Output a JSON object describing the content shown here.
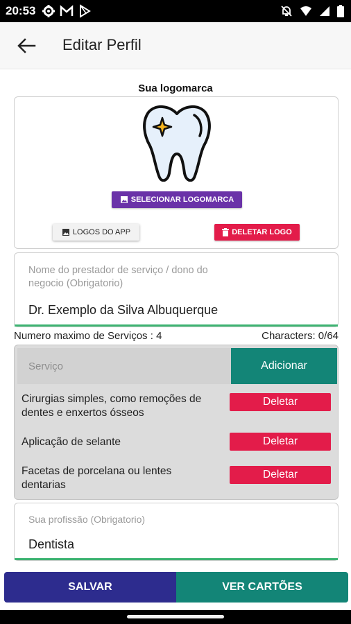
{
  "status_bar": {
    "time": "20:53",
    "left_icons": [
      "gear-icon",
      "gmail-icon",
      "play-store-icon"
    ],
    "right_icons": [
      "notifications-off-icon",
      "wifi-icon",
      "signal-icon",
      "battery-icon"
    ]
  },
  "app_bar": {
    "title": "Editar Perfil",
    "back_icon": "arrow-back-icon"
  },
  "logo_section": {
    "label": "Sua logomarca",
    "select_button": "SELECIONAR LOGOMARCA",
    "app_logos_button": "LOGOS DO APP",
    "delete_button": "DELETAR LOGO"
  },
  "name_field": {
    "placeholder_line1": "Nome do prestador de serviço / dono do",
    "placeholder_line2": "negocio (Obrigatorio)",
    "value": "Dr. Exemplo da Silva Albuquerque"
  },
  "counters": {
    "max_services": "Numero maximo de Serviços : 4",
    "characters": "Characters: 0/64"
  },
  "services": {
    "input_placeholder": "Serviço",
    "add_button": "Adicionar",
    "delete_label": "Deletar",
    "items": [
      {
        "line1": "Cirurgias simples, como remoções de",
        "line2": "dentes e enxertos ósseos"
      },
      {
        "line1": "Aplicação de selante",
        "line2": ""
      },
      {
        "line1": "Facetas de porcelana ou lentes",
        "line2": "dentarias"
      }
    ]
  },
  "profession_field": {
    "placeholder": "Sua profissão (Obrigatorio)",
    "value": "Dentista"
  },
  "bottom_actions": {
    "save": "SALVAR",
    "view_cards": "VER CARTÕES"
  },
  "colors": {
    "purple": "#6a32a8",
    "red": "#e31c4a",
    "teal": "#138577",
    "navy": "#2d2c8e",
    "green_underline": "#3cb371"
  }
}
